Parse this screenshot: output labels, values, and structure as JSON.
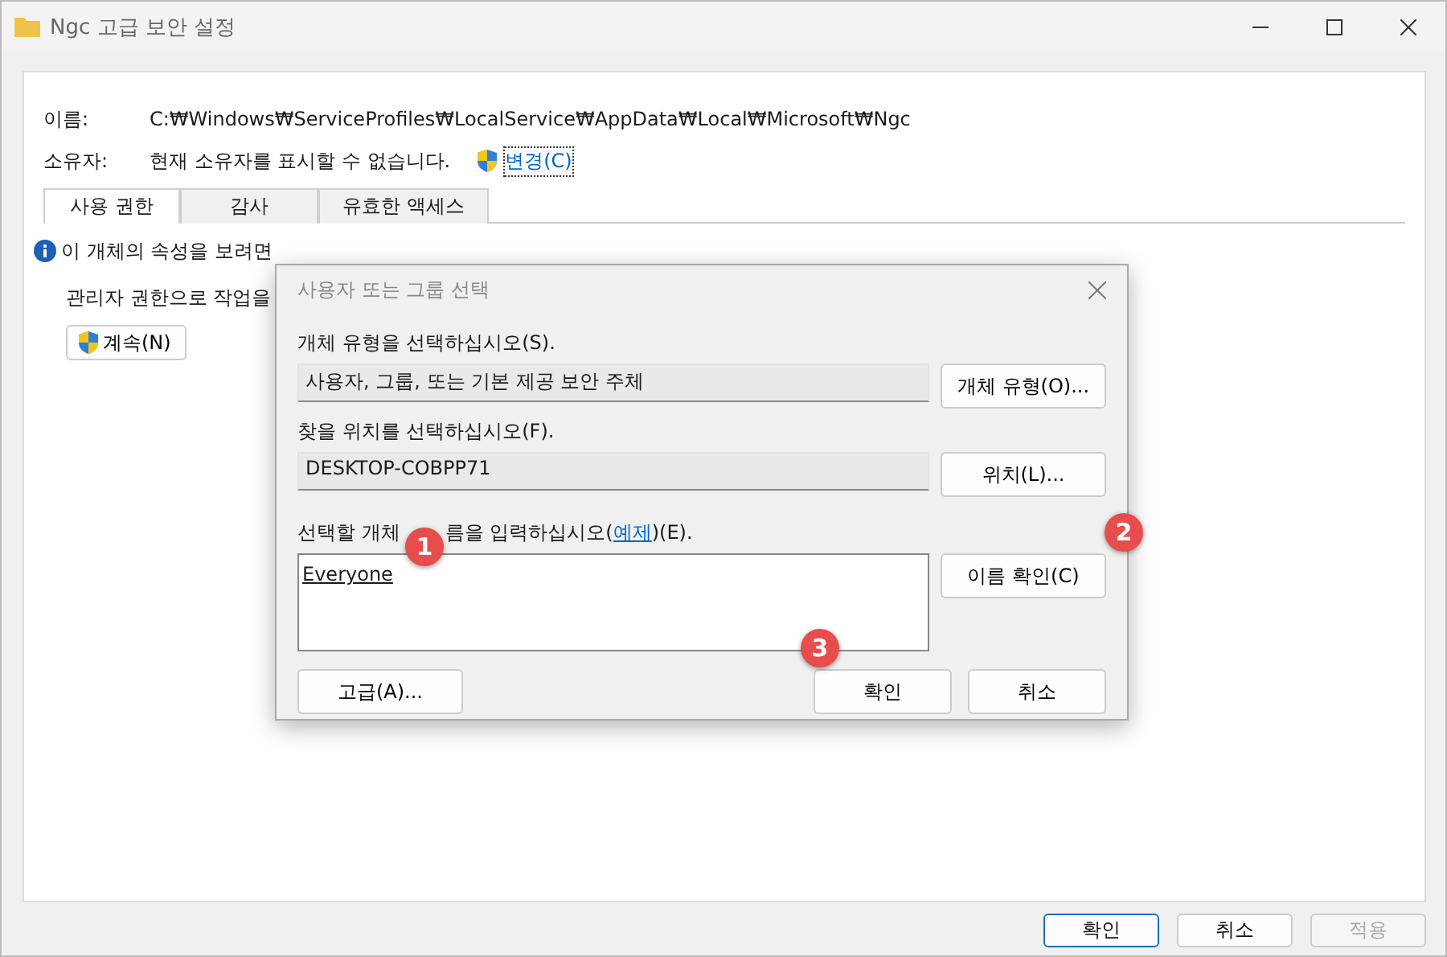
{
  "window": {
    "title": "Ngc 고급 보안 설정"
  },
  "fields": [
    {
      "label": "이름:",
      "value": "C:₩Windows₩ServiceProfiles₩LocalService₩AppData₩Local₩Microsoft₩Ngc"
    },
    {
      "label": "소유자:",
      "value": "현재 소유자를 표시할 수 없습니다.",
      "link": "변경(C)"
    }
  ],
  "tabs": [
    {
      "label": "사용 권한",
      "selected": true
    },
    {
      "label": "감사",
      "selected": false
    },
    {
      "label": "유효한 액세스",
      "selected": false
    }
  ],
  "info": "이 개체의 속성을 보려면",
  "admin_text": "관리자 권한으로 작업을",
  "continue_button": "계속(N)",
  "dialog": {
    "title": "사용자 또는 그룹 선택",
    "object_type_label": "개체 유형을 선택하십시오(S).",
    "object_type": "사용자, 그룹, 또는 기본 제공 보안 주체",
    "object_type_button": "개체 유형(O)...",
    "location_label": "찾을 위치를 선택하십시오(F).",
    "location": "DESKTOP-COBPP71",
    "location_button": "위치(L)...",
    "name_label_before": "선택할 개체",
    "name_label_after": "름을 입력하십시오(",
    "example_link": "예제",
    "name_label_end": ")(E).",
    "name_value": "Everyone",
    "check_names_button": "이름 확인(C)",
    "advanced_button": "고급(A)...",
    "ok_button": "확인",
    "cancel_button": "취소"
  },
  "markers": [
    "1",
    "2",
    "3"
  ],
  "buttons": [
    {
      "label": "확인",
      "disabled": false
    },
    {
      "label": "취소",
      "disabled": false
    },
    {
      "label": "적용",
      "disabled": true
    }
  ]
}
